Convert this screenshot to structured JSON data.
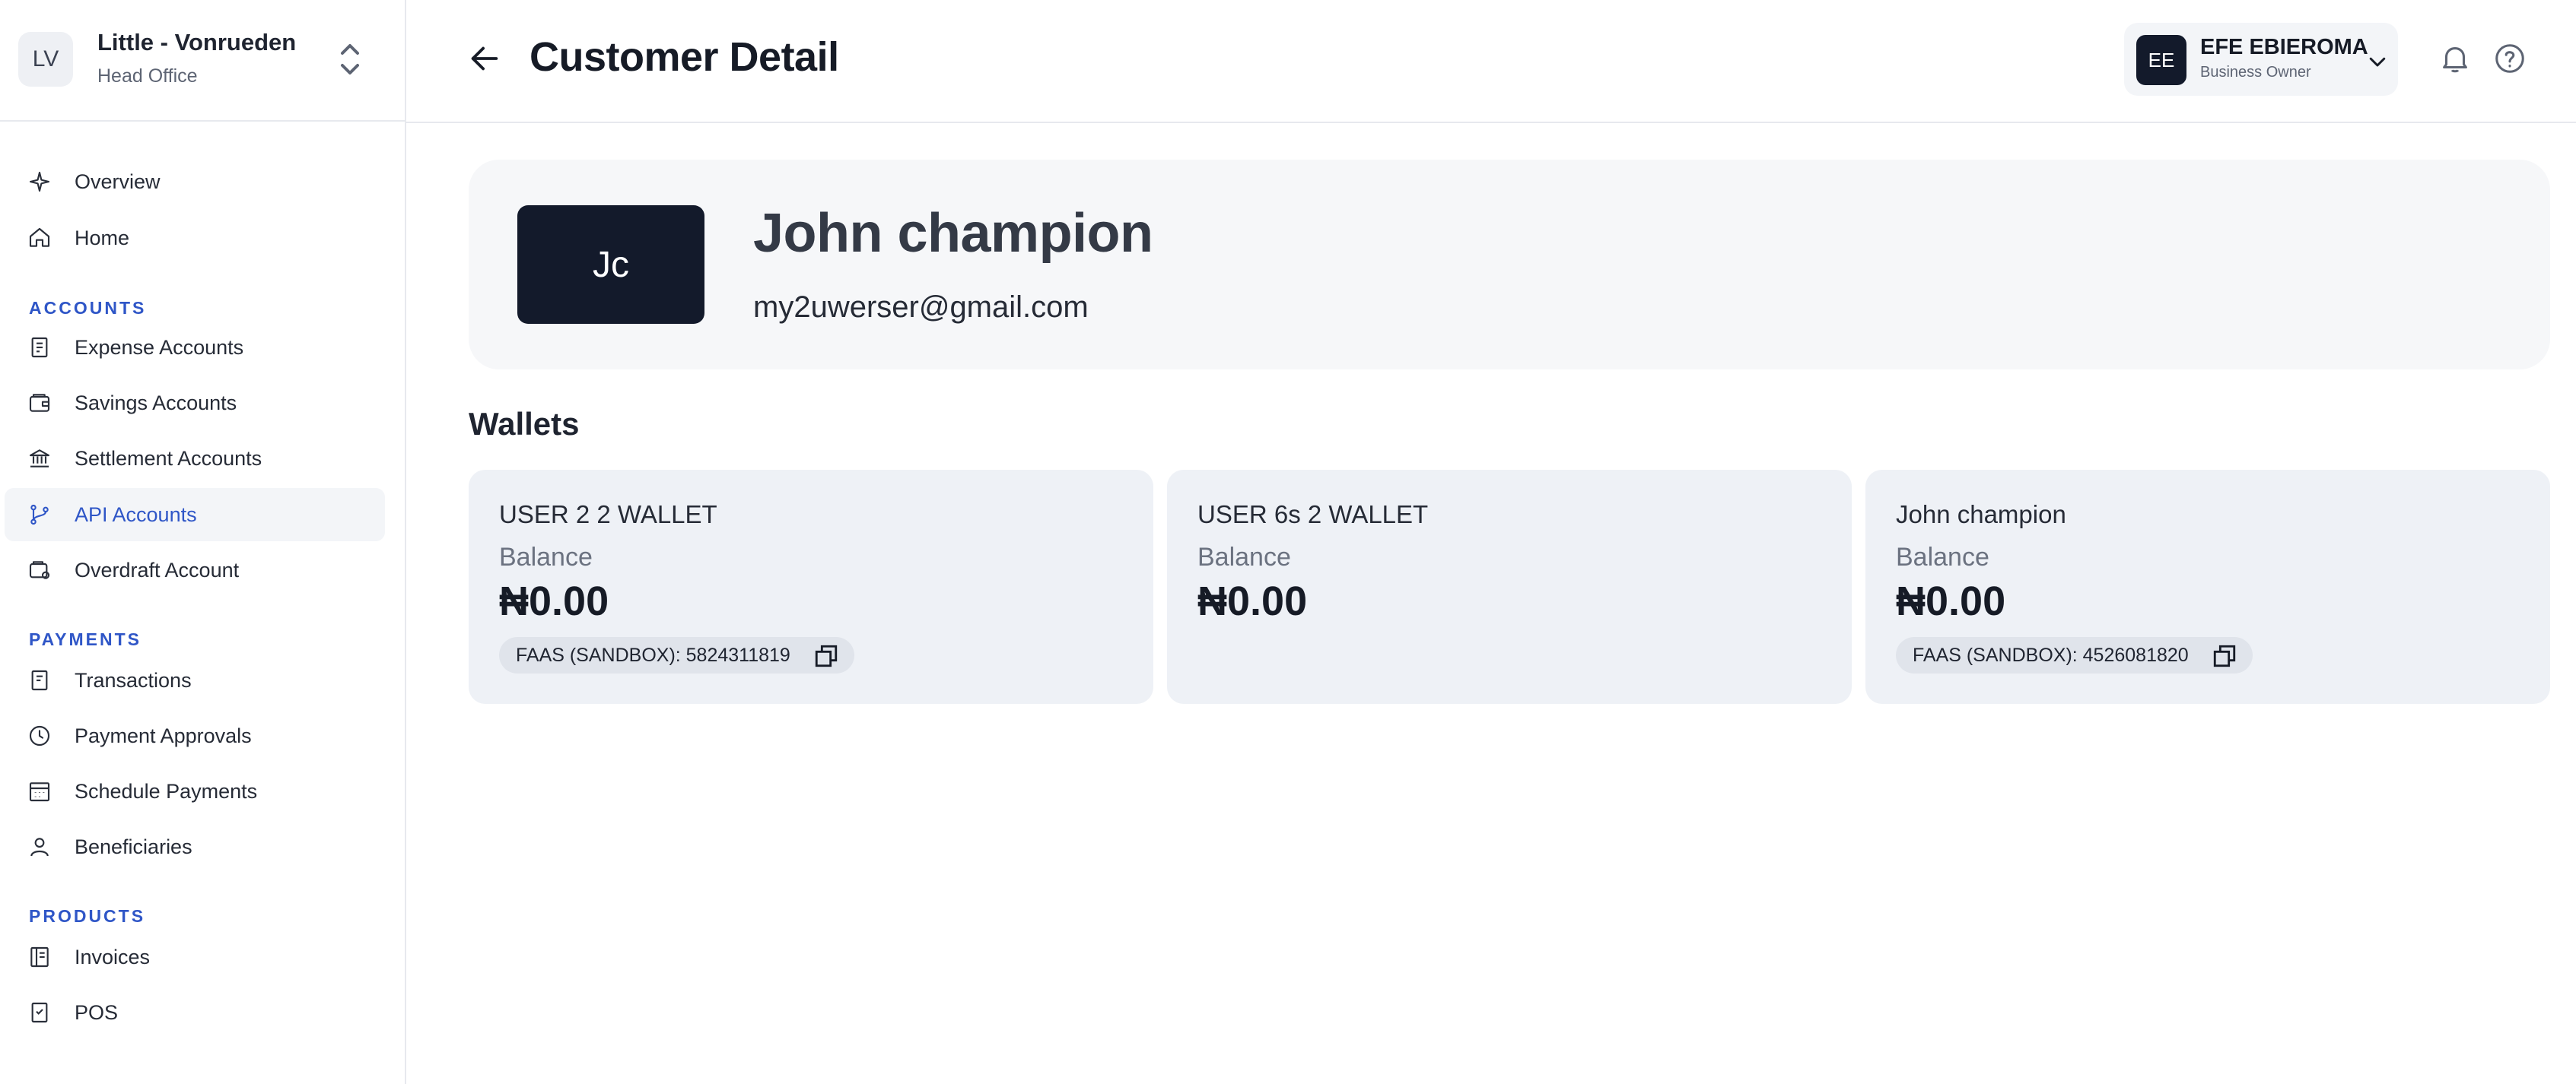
{
  "org": {
    "initials": "LV",
    "name": "Little - Vonrueden",
    "subtitle": "Head Office"
  },
  "nav": {
    "top": [
      {
        "label": "Overview",
        "icon": "sparkle-icon"
      },
      {
        "label": "Home",
        "icon": "home-icon"
      }
    ],
    "sections": [
      {
        "title": "ACCOUNTS",
        "items": [
          {
            "label": "Expense Accounts",
            "icon": "receipt-icon"
          },
          {
            "label": "Savings Accounts",
            "icon": "wallet-icon"
          },
          {
            "label": "Settlement Accounts",
            "icon": "bank-icon"
          },
          {
            "label": "API Accounts",
            "icon": "git-branch-icon",
            "active": true
          },
          {
            "label": "Overdraft Account",
            "icon": "overdraft-icon"
          }
        ]
      },
      {
        "title": "PAYMENTS",
        "items": [
          {
            "label": "Transactions",
            "icon": "document-icon"
          },
          {
            "label": "Payment Approvals",
            "icon": "clock-icon"
          },
          {
            "label": "Schedule Payments",
            "icon": "calendar-icon"
          },
          {
            "label": "Beneficiaries",
            "icon": "user-icon"
          }
        ]
      },
      {
        "title": "PRODUCTS",
        "items": [
          {
            "label": "Invoices",
            "icon": "invoice-icon"
          },
          {
            "label": "POS",
            "icon": "pos-receipt-icon"
          }
        ]
      }
    ]
  },
  "header": {
    "title": "Customer Detail",
    "user": {
      "initials": "EE",
      "name": "EFE EBIEROMA",
      "role": "Business Owner"
    }
  },
  "customer": {
    "initials": "Jc",
    "name": "John champion",
    "email": "my2uwerser@gmail.com"
  },
  "wallets_title": "Wallets",
  "wallets": [
    {
      "name": "USER 2 2 WALLET",
      "balance_label": "Balance",
      "amount": "₦0.00",
      "account": "FAAS (SANDBOX): 5824311819"
    },
    {
      "name": "USER 6s 2 WALLET",
      "balance_label": "Balance",
      "amount": "₦0.00",
      "account": ""
    },
    {
      "name": "John champion",
      "balance_label": "Balance",
      "amount": "₦0.00",
      "account": "FAAS (SANDBOX): 4526081820"
    }
  ],
  "colors": {
    "accent": "#2f56c7",
    "dark": "#131a2b",
    "card": "#eef1f6",
    "profile_card": "#f6f7f9"
  }
}
